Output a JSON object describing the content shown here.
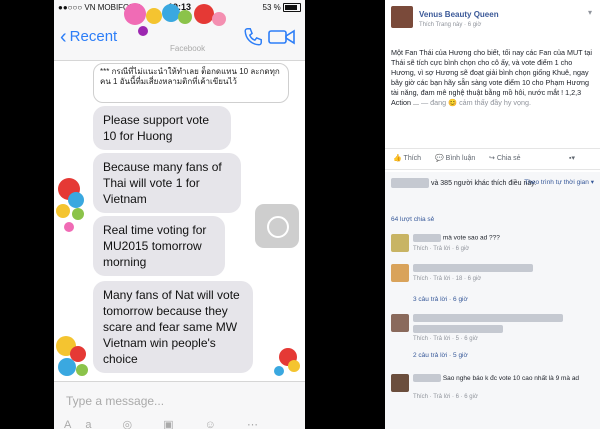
{
  "messenger": {
    "status": {
      "carrier": "●●○○○ VN MOBIFONE",
      "network": "3G",
      "time": "19:13",
      "battery": "53 %"
    },
    "nav": {
      "back_label": "Recent",
      "title": "Facebook",
      "phone_icon": "phone-icon",
      "video_icon": "video-camera-icon"
    },
    "messages": [
      {
        "text": "*** กรณีที่ไม่แนะนำให้ทำเลย ต็อกดแทน 10 ละกดทุกคน 1 อันนี้ที่มเสี่ยงหลามติกที่เค้าเขียนไว้",
        "type": "quoted"
      },
      {
        "text": "Please support vote 10 for Huong",
        "type": "received"
      },
      {
        "text": "Because many fans of Thai will vote 1 for Vietnam",
        "type": "received"
      },
      {
        "text": "Real time voting for MU2015 tomorrow morning",
        "type": "received"
      },
      {
        "text": "Many fans of Nat will vote tomorrow because they scare and fear same MW Vietnam win people's choice",
        "type": "received"
      }
    ],
    "input_placeholder": "Type a message...",
    "input_icons": [
      "Aa",
      "camera-icon",
      "image-icon",
      "sticker-icon",
      "more-icon"
    ]
  },
  "facebook": {
    "page_name": "Venus Beauty Queen",
    "subtitle": "Thích Trang này · 6 giờ",
    "post_text": "Một Fan Thái của Hương cho biết, tối nay các Fan của MUT tại Thái sẽ tích cực bình chọn cho cô ấy, và vote điểm 1 cho Hương, vì sợ Hương sẽ đoạt giải bình chọn giống Khuê, ngay bây giờ các bạn hãy sẵn sàng vote điểm 10 cho Phạm Hương tài năng, đam mê nghệ thuật bằng mồ hôi, nước mắt ! 1,2,3 Action ...",
    "feeling": "— đang 😊 cảm thấy đầy hy vọng.",
    "actions": {
      "like": "Thích",
      "comment": "Bình luận",
      "share": "Chia sẻ"
    },
    "likes_text": "và 385 người khác thích điều này.",
    "sort_label": "Theo trình tự thời gian",
    "shares": "64 lượt chia sẻ",
    "comments": [
      {
        "text": "mà vote sao ad ???",
        "meta": "Thích · Trả lời · 6 giờ"
      },
      {
        "text": "",
        "meta": "Thích · Trả lời · 18 · 6 giờ"
      },
      {
        "text": "3 câu trả lời · 6 giờ",
        "meta": ""
      },
      {
        "text": "",
        "meta": "Thích · Trả lời · 5 · 6 giờ"
      },
      {
        "text": "2 câu trả lời · 5 giờ",
        "meta": ""
      },
      {
        "text": "Sao nghe báo k đc vote 10 cao nhất là 9 mà ad",
        "meta": "Thích · Trả lời · 6 · 6 giờ"
      }
    ]
  }
}
